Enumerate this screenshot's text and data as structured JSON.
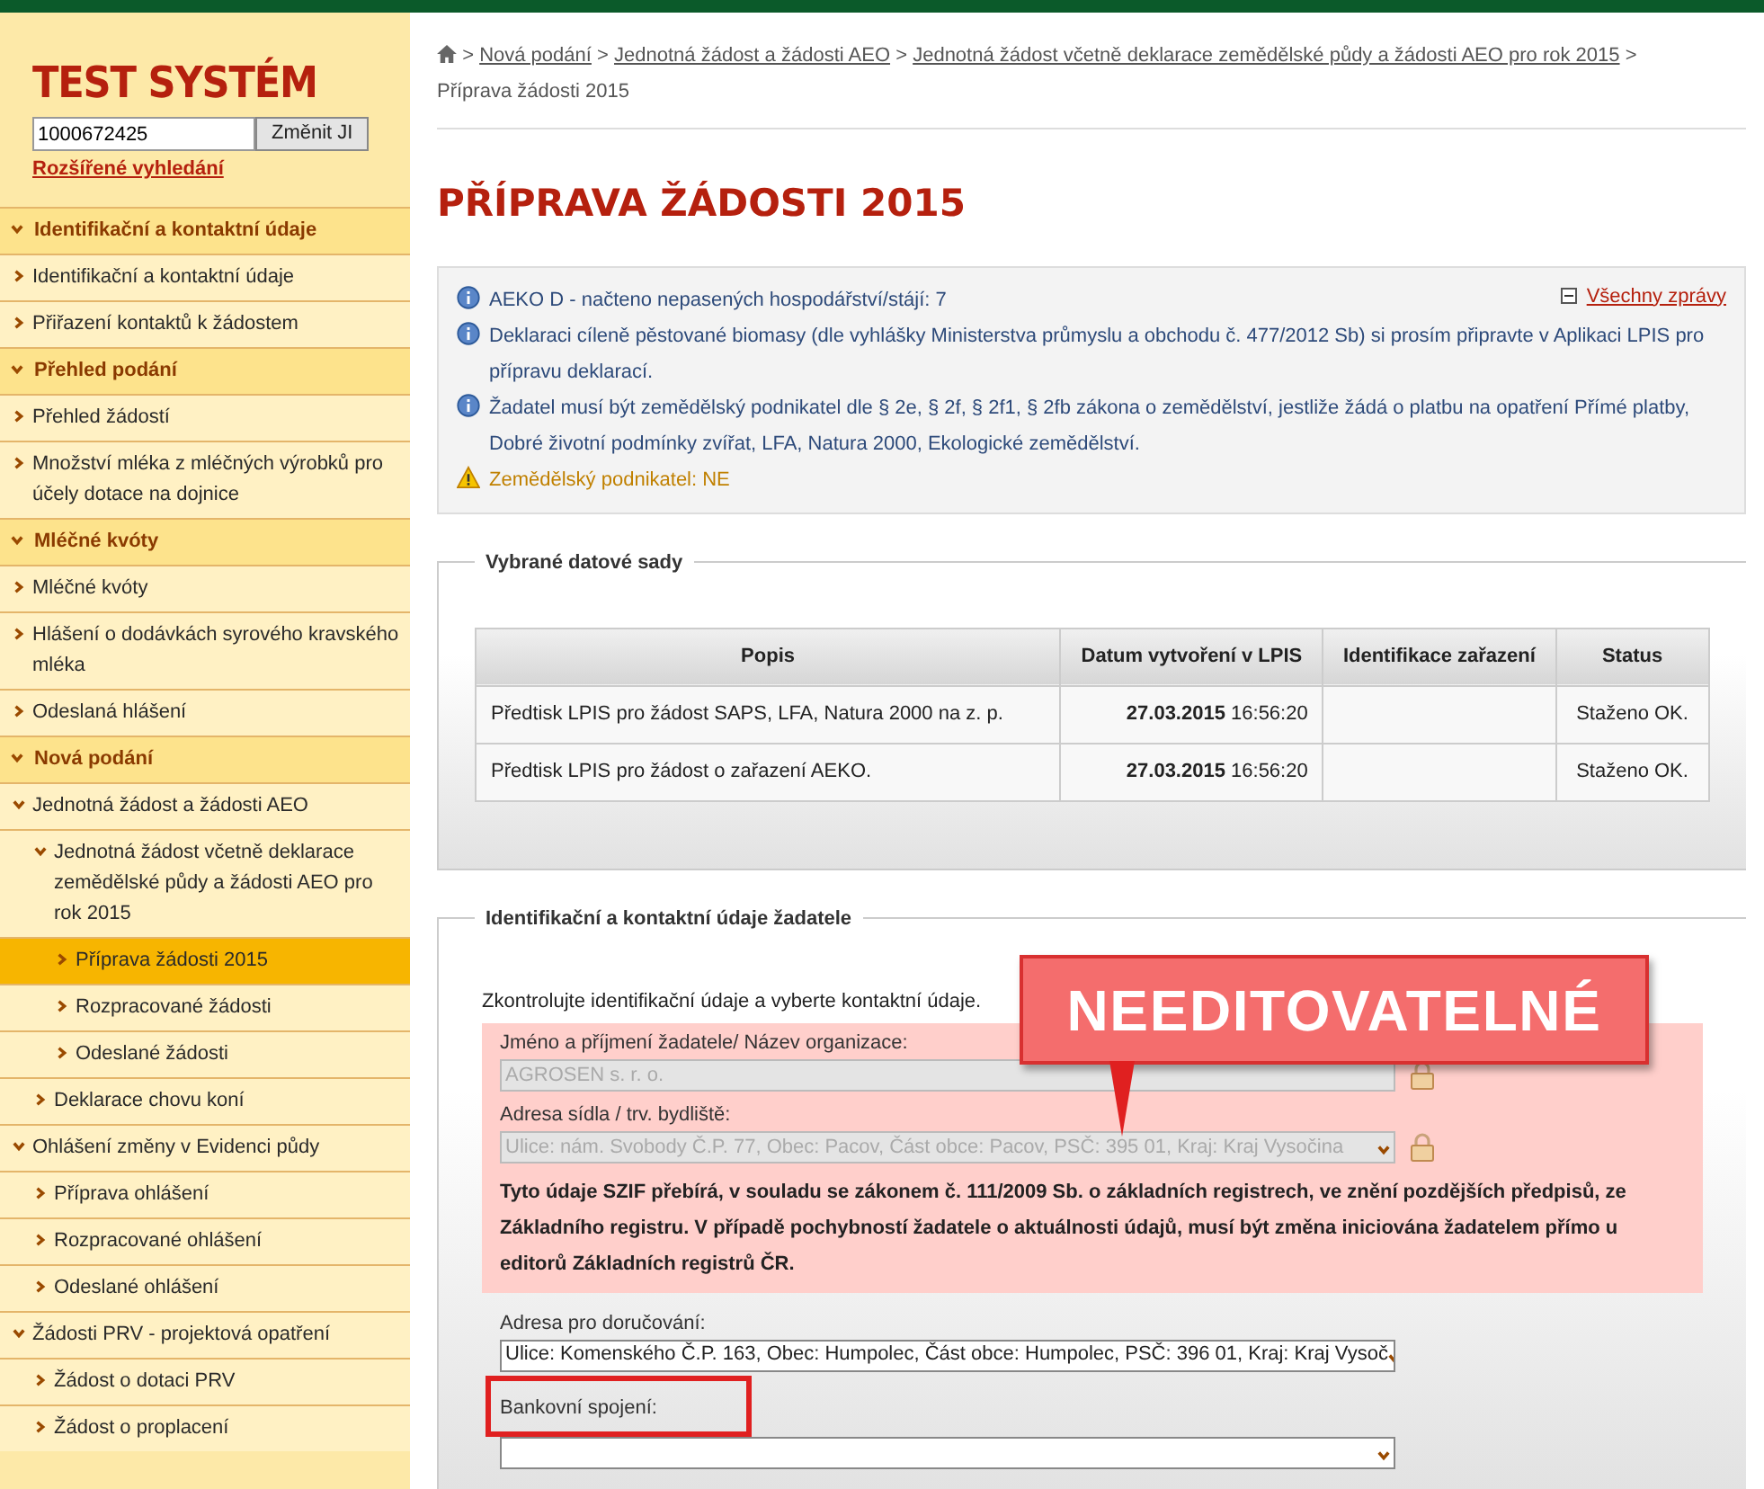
{
  "sidebar": {
    "title": "TEST SYSTÉM",
    "search": {
      "value": "1000672425"
    },
    "search_button": "Změnit JI",
    "advanced_link": "Rozšířené vyhledání",
    "sections": [
      {
        "label": "Identifikační a kontaktní údaje",
        "expanded": true,
        "children": [
          {
            "label": "Identifikační a kontaktní údaje",
            "expanded": false,
            "selected": false
          },
          {
            "label": "Přiřazení kontaktů k žádostem",
            "expanded": false,
            "selected": false
          }
        ]
      },
      {
        "label": "Přehled podání",
        "expanded": true,
        "children": [
          {
            "label": "Přehled žádostí",
            "expanded": false,
            "selected": false
          },
          {
            "label": "Množství mléka z mléčných výrobků pro účely dotace na dojnice",
            "expanded": false,
            "selected": false
          }
        ]
      },
      {
        "label": "Mléčné kvóty",
        "expanded": true,
        "children": [
          {
            "label": "Mléčné kvóty",
            "expanded": false,
            "selected": false
          },
          {
            "label": "Hlášení o dodávkách syrového kravského mléka",
            "expanded": false,
            "selected": false
          },
          {
            "label": "Odeslaná hlášení",
            "expanded": false,
            "selected": false
          }
        ]
      },
      {
        "label": "Nová podání",
        "expanded": true,
        "children": [
          {
            "label": "Jednotná žádost a žádosti AEO",
            "expanded": true,
            "selected": false,
            "children": [
              {
                "label": "Jednotná žádost včetně deklarace zemědělské půdy a žádosti AEO pro rok 2015",
                "expanded": true,
                "selected": false,
                "children": [
                  {
                    "label": "Příprava žádosti 2015",
                    "expanded": false,
                    "selected": true
                  },
                  {
                    "label": "Rozpracované žádosti",
                    "expanded": false,
                    "selected": false
                  },
                  {
                    "label": "Odeslané žádosti",
                    "expanded": false,
                    "selected": false
                  }
                ]
              },
              {
                "label": "Deklarace chovu koní",
                "expanded": false,
                "selected": false
              }
            ]
          },
          {
            "label": "Ohlášení změny v Evidenci půdy",
            "expanded": true,
            "selected": false,
            "children": [
              {
                "label": "Příprava ohlášení",
                "expanded": false,
                "selected": false
              },
              {
                "label": "Rozpracované ohlášení",
                "expanded": false,
                "selected": false
              },
              {
                "label": "Odeslané ohlášení",
                "expanded": false,
                "selected": false
              }
            ]
          },
          {
            "label": "Žádosti PRV - projektová opatření",
            "expanded": true,
            "selected": false,
            "children": [
              {
                "label": "Žádost o dotaci PRV",
                "expanded": false,
                "selected": false
              },
              {
                "label": "Žádost o proplacení",
                "expanded": false,
                "selected": false
              }
            ]
          }
        ]
      }
    ]
  },
  "breadcrumb": [
    {
      "kind": "separator",
      "label": ">"
    },
    {
      "kind": "link",
      "label": "Nová podání"
    },
    {
      "kind": "separator",
      "label": ">"
    },
    {
      "kind": "link",
      "label": "Jednotná žádost a žádosti AEO"
    },
    {
      "kind": "separator",
      "label": ">"
    },
    {
      "kind": "link",
      "label": "Jednotná žádost včetně deklarace zemědělské půdy a žádosti AEO pro rok 2015"
    },
    {
      "kind": "separator",
      "label": ">"
    },
    {
      "kind": "current",
      "label": "Příprava žádosti 2015"
    }
  ],
  "page_title": "PŘÍPRAVA ŽÁDOSTI 2015",
  "messages": [
    {
      "kind": "info",
      "text": "AEKO D - načteno nepasených hospodářství/stájí: 7"
    },
    {
      "kind": "info",
      "text": "Deklaraci cíleně pěstované biomasy (dle vyhlášky Ministerstva průmyslu a obchodu č. 477/2012 Sb) si prosím připravte v Aplikaci LPIS pro přípravu deklarací."
    },
    {
      "kind": "info",
      "text": "Žadatel musí být zemědělský podnikatel dle § 2e, § 2f, § 2f1, § 2fb zákona o zemědělství, jestliže žádá o platbu na opatření Přímé platby, Dobré životní podmínky zvířat, LFA, Natura 2000, Ekologické zemědělství."
    },
    {
      "kind": "warning",
      "text": "Zemědělský podnikatel: NE"
    }
  ],
  "all_messages_link": "Všechny zprávy",
  "datasets": {
    "legend": "Vybrané datové sady",
    "columns": [
      "Popis",
      "Datum vytvoření v LPIS",
      "Identifikace zařazení",
      "Status"
    ],
    "rows": [
      [
        "Předtisk LPIS pro žádost SAPS, LFA, Natura 2000 na z. p.",
        "**27.03.2015** 16:56:20",
        "",
        "Staženo OK."
      ],
      [
        "Předtisk LPIS pro žádost o zařazení AEKO.",
        "**27.03.2015** 16:56:20",
        "",
        "Staženo OK."
      ]
    ]
  },
  "applicant": {
    "legend": "Identifikační a kontaktní údaje žadatele",
    "instruction": "Zkontrolujte identifikační údaje a vyberte kontaktní údaje.",
    "locked_fields": [
      {
        "kind": "text",
        "disabled": true,
        "label": "Jméno a příjmení žadatele/ Název organizace:",
        "value": "AGROSEN s. r. o."
      },
      {
        "kind": "select",
        "disabled": true,
        "label": "Adresa sídla / trv. bydliště:",
        "value": "Ulice: nám. Svobody Č.P. 77, Obec: Pacov, Část obce: Pacov, PSČ: 395 01, Kraj: Kraj Vysočina"
      }
    ],
    "notice": "Tyto údaje SZIF přebírá, v souladu se zákonem č. 111/2009 Sb. o základních registrech, ve znění pozdějších předpisů, ze Základního registru. V případě pochybností žadatele o aktuálnosti údajů, musí být změna iniciována žadatelem přímo u editorů Základních registrů ČR.",
    "callout": "NEEDITOVATELNÉ",
    "fields": [
      {
        "label": "Adresa pro doručování:",
        "value": "Ulice: Komenského Č.P. 163, Obec: Humpolec, Část obce: Humpolec, PSČ: 396 01, Kraj: Kraj Vysoč",
        "highlighted": false
      },
      {
        "label": "Bankovní spojení:",
        "highlighted": true
      }
    ]
  }
}
